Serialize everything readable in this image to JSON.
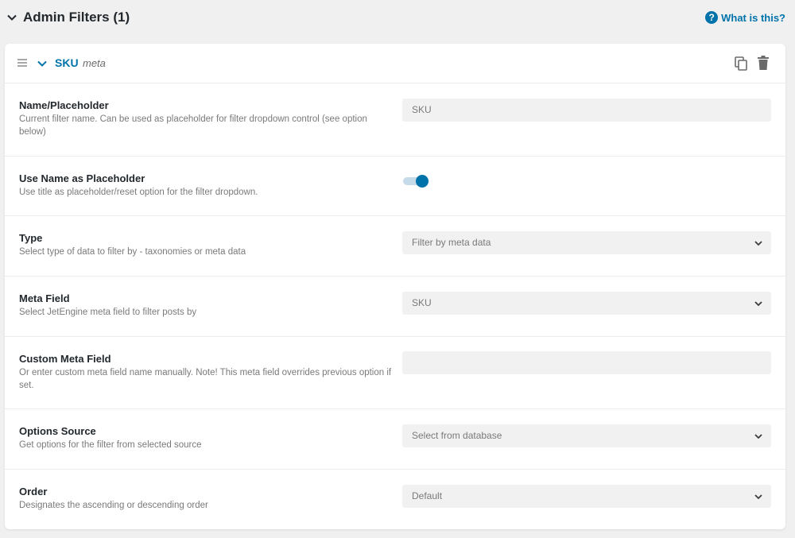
{
  "section": {
    "title": "Admin Filters (1)",
    "help_label": "What is this?",
    "help_icon": "question-icon"
  },
  "filter": {
    "name": "SKU",
    "subtype": "meta",
    "icons": [
      "drag-handle-icon",
      "chevron-down-icon",
      "copy-icon",
      "trash-icon"
    ]
  },
  "rows": [
    {
      "label": "Name/Placeholder",
      "description": "Current filter name. Can be used as placeholder for filter dropdown control (see option below)",
      "control": "input",
      "value": "SKU"
    },
    {
      "label": "Use Name as Placeholder",
      "description": "Use title as placeholder/reset option for the filter dropdown.",
      "control": "toggle",
      "enabled": true
    },
    {
      "label": "Type",
      "description": "Select type of data to filter by - taxonomies or meta data",
      "control": "select",
      "value": "Filter by meta data"
    },
    {
      "label": "Meta Field",
      "description": "Select JetEngine meta field to filter posts by",
      "control": "select",
      "value": "SKU"
    },
    {
      "label": "Custom Meta Field",
      "description": "Or enter custom meta field name manually. Note! This meta field overrides previous option if set.",
      "control": "input",
      "value": ""
    },
    {
      "label": "Options Source",
      "description": "Get options for the filter from selected source",
      "control": "select",
      "value": "Select from database"
    },
    {
      "label": "Order",
      "description": "Designates the ascending or descending order",
      "control": "select",
      "value": "Default"
    }
  ],
  "colors": {
    "accent": "#0073aa",
    "background": "#f0f0f1",
    "card": "#ffffff",
    "field": "#f1f1f1"
  }
}
